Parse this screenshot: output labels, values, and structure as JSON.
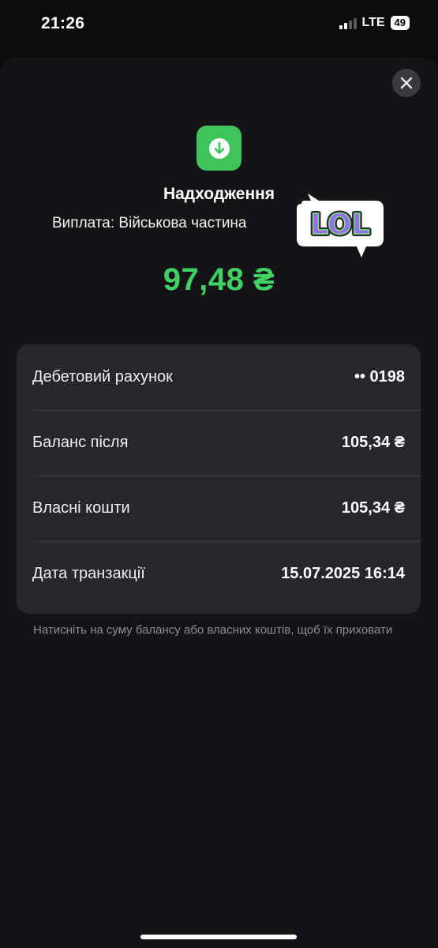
{
  "status_bar": {
    "time": "21:26",
    "network": "LTE",
    "battery": "49"
  },
  "transaction": {
    "title": "Надходження",
    "subtitle": "Виплата: Військова частина",
    "amount": "97,48 ₴",
    "amount_color": "#3fd164",
    "icon": "arrow-down-icon",
    "sticker_text": "LOL"
  },
  "details": [
    {
      "label": "Дебетовий рахунок",
      "value": "•• 0198"
    },
    {
      "label": "Баланс після",
      "value": "105,34 ₴"
    },
    {
      "label": "Власні кошти",
      "value": "105,34 ₴"
    },
    {
      "label": "Дата транзакції",
      "value": "15.07.2025 16:14"
    }
  ],
  "hint": "Натисніть на суму балансу або власних коштів, щоб їх приховати"
}
